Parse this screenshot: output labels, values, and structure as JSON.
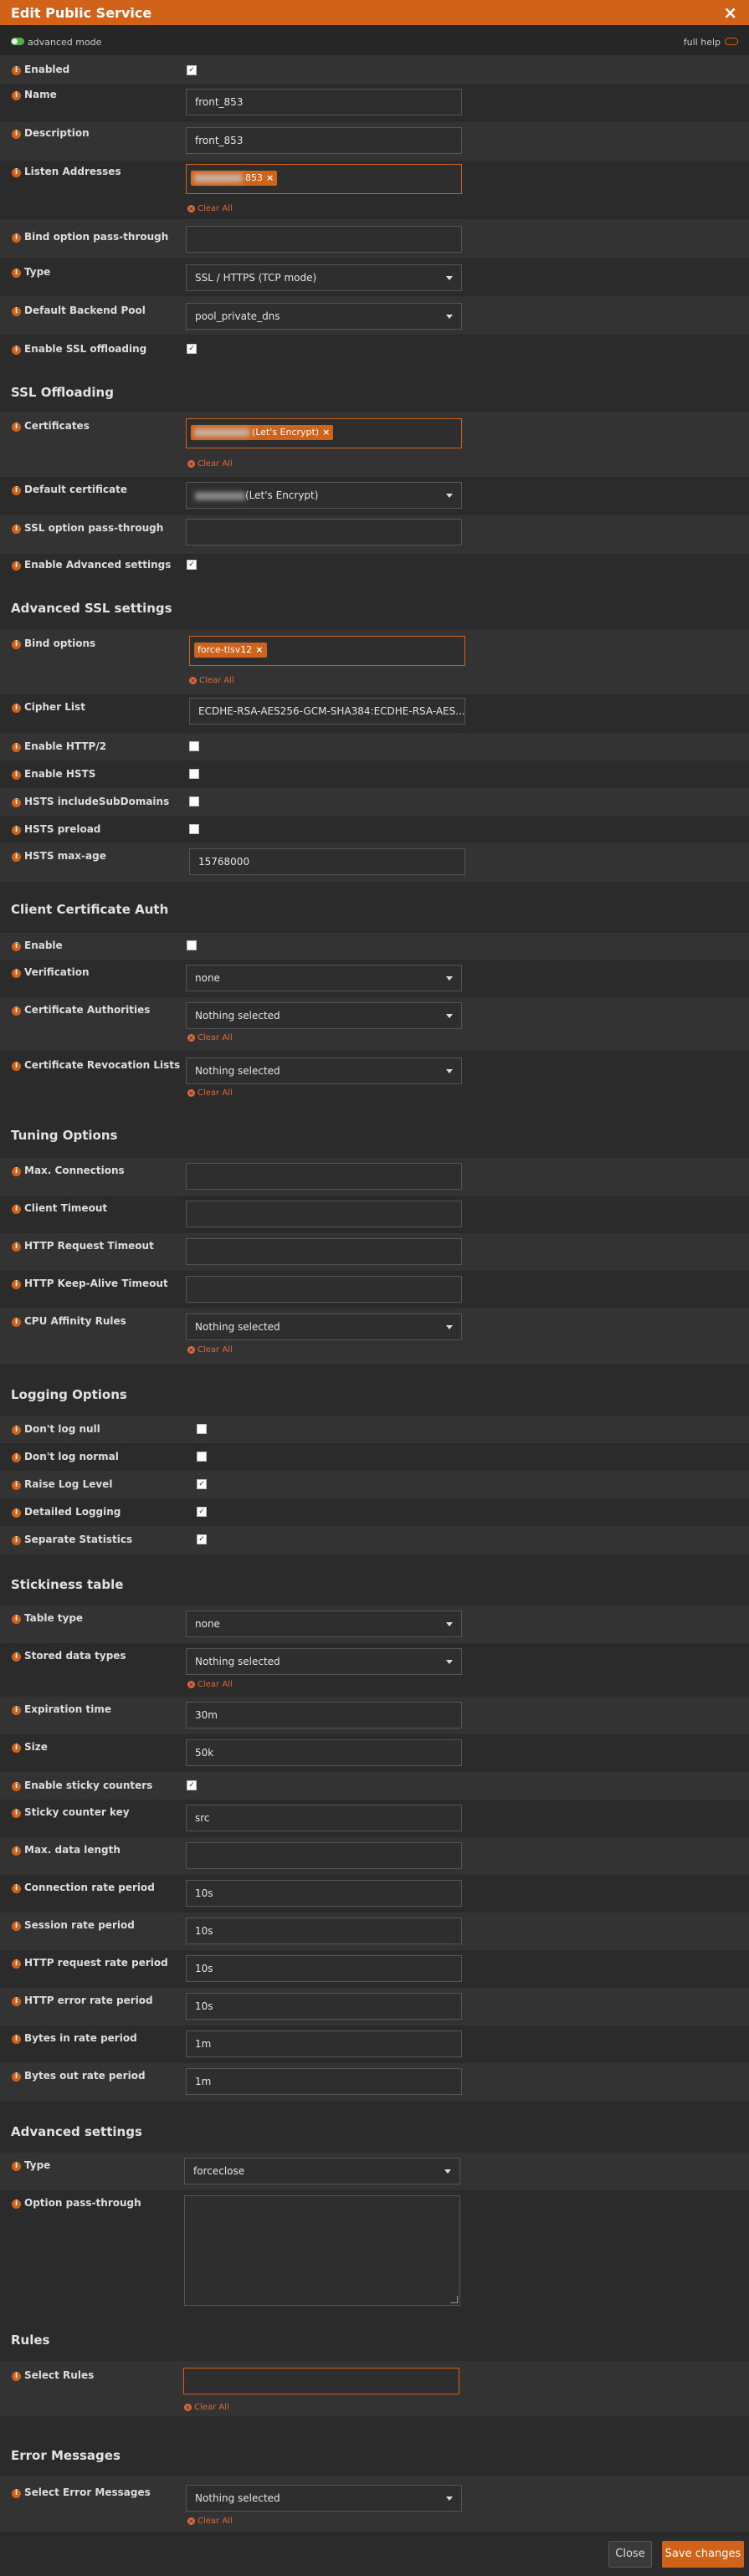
{
  "dialog": {
    "title": "Edit Public Service",
    "close_glyph": "×",
    "advanced_mode_label": "advanced mode",
    "full_help_label": "full help"
  },
  "icons": {
    "info": "i",
    "clear": "×",
    "check": "✓"
  },
  "clear_all_label": "Clear All",
  "general": {
    "enabled": {
      "label": "Enabled",
      "checked": true
    },
    "name": {
      "label": "Name",
      "value": "front_853"
    },
    "description": {
      "label": "Description",
      "value": "front_853"
    },
    "listen_addresses": {
      "label": "Listen Addresses",
      "tag_suffix": "853"
    },
    "bind_option_passthrough": {
      "label": "Bind option pass-through",
      "value": ""
    },
    "type": {
      "label": "Type",
      "value": "SSL / HTTPS (TCP mode)"
    },
    "default_backend_pool": {
      "label": "Default Backend Pool",
      "value": "pool_private_dns"
    },
    "enable_ssl_offloading": {
      "label": "Enable SSL offloading",
      "checked": true
    }
  },
  "ssl_offloading": {
    "title": "SSL Offloading",
    "certificates": {
      "label": "Certificates",
      "tag_suffix": "(Let's Encrypt)"
    },
    "default_certificate": {
      "label": "Default certificate",
      "suffix": "(Let's Encrypt)"
    },
    "ssl_option_passthrough": {
      "label": "SSL option pass-through",
      "value": ""
    },
    "enable_advanced_settings": {
      "label": "Enable Advanced settings",
      "checked": true
    }
  },
  "advanced_ssl": {
    "title": "Advanced SSL settings",
    "bind_options": {
      "label": "Bind options",
      "tag": "force-tlsv12"
    },
    "cipher_list": {
      "label": "Cipher List",
      "value": "ECDHE-RSA-AES256-GCM-SHA384:ECDHE-RSA-AES..."
    },
    "enable_http2": {
      "label": "Enable HTTP/2",
      "checked": false
    },
    "enable_hsts": {
      "label": "Enable HSTS",
      "checked": false
    },
    "hsts_include_subdomains": {
      "label": "HSTS includeSubDomains",
      "checked": false
    },
    "hsts_preload": {
      "label": "HSTS preload",
      "checked": false
    },
    "hsts_max_age": {
      "label": "HSTS max-age",
      "value": "15768000"
    }
  },
  "client_cert_auth": {
    "title": "Client Certificate Auth",
    "enable": {
      "label": "Enable",
      "checked": false
    },
    "verification": {
      "label": "Verification",
      "value": "none"
    },
    "certificate_authorities": {
      "label": "Certificate Authorities",
      "value": "Nothing selected"
    },
    "certificate_revocation_lists": {
      "label": "Certificate Revocation Lists",
      "value": "Nothing selected"
    }
  },
  "tuning": {
    "title": "Tuning Options",
    "max_connections": {
      "label": "Max. Connections",
      "value": ""
    },
    "client_timeout": {
      "label": "Client Timeout",
      "value": ""
    },
    "http_request_timeout": {
      "label": "HTTP Request Timeout",
      "value": ""
    },
    "http_keepalive_timeout": {
      "label": "HTTP Keep-Alive Timeout",
      "value": ""
    },
    "cpu_affinity_rules": {
      "label": "CPU Affinity Rules",
      "value": "Nothing selected"
    }
  },
  "logging": {
    "title": "Logging Options",
    "dont_log_null": {
      "label": "Don't log null",
      "checked": false
    },
    "dont_log_normal": {
      "label": "Don't log normal",
      "checked": false
    },
    "raise_log_level": {
      "label": "Raise Log Level",
      "checked": true
    },
    "detailed_logging": {
      "label": "Detailed Logging",
      "checked": true
    },
    "separate_statistics": {
      "label": "Separate Statistics",
      "checked": true
    }
  },
  "stickiness": {
    "title": "Stickiness table",
    "table_type": {
      "label": "Table type",
      "value": "none"
    },
    "stored_data_types": {
      "label": "Stored data types",
      "value": "Nothing selected"
    },
    "expiration_time": {
      "label": "Expiration time",
      "value": "30m"
    },
    "size": {
      "label": "Size",
      "value": "50k"
    },
    "enable_sticky_counters": {
      "label": "Enable sticky counters",
      "checked": true
    },
    "sticky_counter_key": {
      "label": "Sticky counter key",
      "value": "src"
    },
    "max_data_length": {
      "label": "Max. data length",
      "value": ""
    },
    "connection_rate_period": {
      "label": "Connection rate period",
      "value": "10s"
    },
    "session_rate_period": {
      "label": "Session rate period",
      "value": "10s"
    },
    "http_request_rate_period": {
      "label": "HTTP request rate period",
      "value": "10s"
    },
    "http_error_rate_period": {
      "label": "HTTP error rate period",
      "value": "10s"
    },
    "bytes_in_rate_period": {
      "label": "Bytes in rate period",
      "value": "1m"
    },
    "bytes_out_rate_period": {
      "label": "Bytes out rate period",
      "value": "1m"
    }
  },
  "advanced_settings": {
    "title": "Advanced settings",
    "type": {
      "label": "Type",
      "value": "forceclose"
    },
    "option_passthrough": {
      "label": "Option pass-through",
      "value": ""
    }
  },
  "rules": {
    "title": "Rules",
    "select_rules": {
      "label": "Select Rules",
      "value": ""
    }
  },
  "error_messages": {
    "title": "Error Messages",
    "select_error_messages": {
      "label": "Select Error Messages",
      "value": "Nothing selected"
    }
  },
  "footer": {
    "close_label": "Close",
    "save_label": "Save changes"
  },
  "colors": {
    "accent": "#d0621a",
    "toggle_on": "#4caf50",
    "background": "#2b2b2b",
    "row_alt": "#333333"
  }
}
